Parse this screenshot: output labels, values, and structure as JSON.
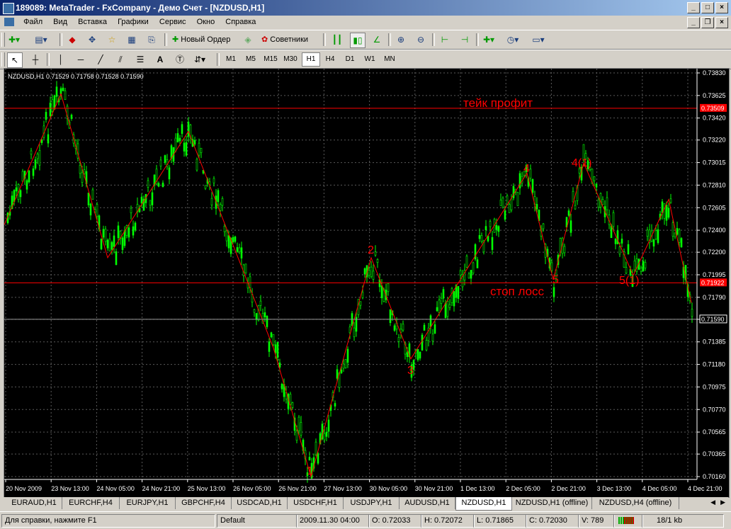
{
  "window": {
    "title": "189089: MetaTrader - FxCompany - Демо Счет - [NZDUSD,H1]"
  },
  "menu": [
    "Файл",
    "Вид",
    "Вставка",
    "Графики",
    "Сервис",
    "Окно",
    "Справка"
  ],
  "toolbar": {
    "new_order": "Новый Ордер",
    "experts": "Советники"
  },
  "drawing_tools": {
    "text_tool": "A"
  },
  "timeframes": [
    "M1",
    "M5",
    "M15",
    "M30",
    "H1",
    "H4",
    "D1",
    "W1",
    "MN"
  ],
  "active_timeframe": "H1",
  "chart": {
    "symbol_info": "NZDUSD,H1  0.71529 0.71758 0.71528 0.71590",
    "price_labels": [
      "0.73830",
      "0.73625",
      "0.73420",
      "0.73220",
      "0.73015",
      "0.72810",
      "0.72605",
      "0.72400",
      "0.72200",
      "0.71995",
      "0.71790",
      "0.71590",
      "0.71385",
      "0.71180",
      "0.70975",
      "0.70770",
      "0.70565",
      "0.70365",
      "0.70160"
    ],
    "time_labels": [
      "20 Nov 2009",
      "23 Nov 13:00",
      "24 Nov 05:00",
      "24 Nov 21:00",
      "25 Nov 13:00",
      "26 Nov 05:00",
      "26 Nov 21:00",
      "27 Nov 13:00",
      "30 Nov 05:00",
      "30 Nov 21:00",
      "1 Dec 13:00",
      "2 Dec 05:00",
      "2 Dec 21:00",
      "3 Dec 13:00",
      "4 Dec 05:00",
      "4 Dec 21:00"
    ],
    "take_profit": {
      "label": "тейк профит",
      "price": "0.73509"
    },
    "stop_loss": {
      "label": "стоп лосс",
      "price": "0.71922"
    },
    "current_price": "0.71590",
    "wave_labels": [
      "1",
      "2",
      "3",
      "4",
      "5",
      "4(1)",
      "5(1)"
    ],
    "colors": {
      "background": "#000000",
      "candles": "#00ff00",
      "lines": "#ff0000",
      "grid": "#5a5a5a"
    }
  },
  "chart_data": {
    "type": "candlestick",
    "ylim": [
      0.7016,
      0.7383
    ],
    "zigzag_prices": [
      0.7245,
      0.7364,
      0.7215,
      0.733,
      0.7133,
      0.7016,
      0.7215,
      0.7123,
      0.7292,
      0.7195,
      0.7301,
      0.7199,
      0.7268,
      0.7174
    ]
  },
  "tabs": [
    "EURAUD,H1",
    "EURCHF,H4",
    "EURJPY,H1",
    "GBPCHF,H4",
    "USDCAD,H1",
    "USDCHF,H1",
    "USDJPY,H1",
    "AUDUSD,H1",
    "NZDUSD,H1",
    "NZDUSD,H1 (offline)",
    "NZDUSD,H4 (offline)"
  ],
  "active_tab": "NZDUSD,H1",
  "status": {
    "help": "Для справки, нажмите F1",
    "profile": "Default",
    "datetime": "2009.11.30 04:00",
    "open": "O: 0.72033",
    "high": "H: 0.72072",
    "low": "L: 0.71865",
    "close": "C: 0.72030",
    "volume": "V: 789",
    "traffic": "18/1 kb"
  }
}
